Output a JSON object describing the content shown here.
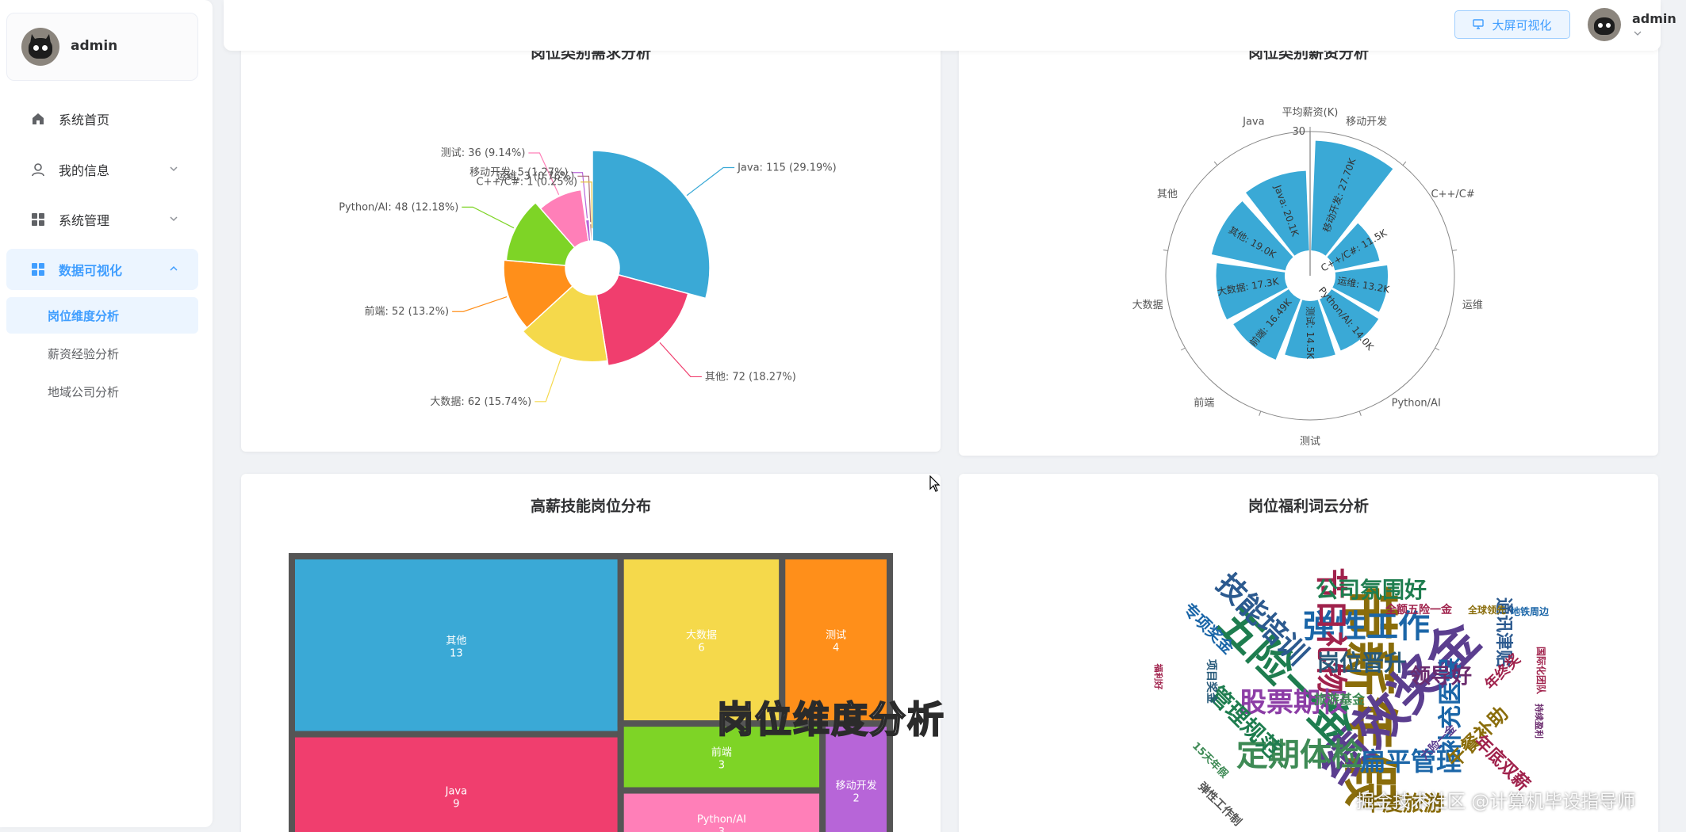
{
  "sidebar": {
    "user_name": "admin",
    "menu": [
      {
        "label": "系统首页",
        "icon": "home-icon"
      },
      {
        "label": "我的信息",
        "icon": "user-icon"
      },
      {
        "label": "系统管理",
        "icon": "grid-icon"
      },
      {
        "label": "数据可视化",
        "icon": "grid-icon"
      }
    ],
    "submenu": [
      {
        "label": "岗位维度分析"
      },
      {
        "label": "薪资经验分析"
      },
      {
        "label": "地域公司分析"
      }
    ]
  },
  "header": {
    "bigscreen_label": "大屏可视化",
    "user_name": "admin"
  },
  "colors": {
    "accent": "#409eff",
    "active_bg": "#ecf5ff"
  },
  "overlay": {
    "caption": "岗位维度分析",
    "watermark": "掘金技术社区 @计算机毕设指导师"
  },
  "cards": {
    "demand": {
      "title": "岗位类别需求分析"
    },
    "salary": {
      "title": "岗位类别薪资分析"
    },
    "treemap": {
      "title": "高薪技能岗位分布"
    },
    "wordcloud": {
      "title": "岗位福利词云分析"
    }
  },
  "chart_data": [
    {
      "type": "pie",
      "variant": "rose",
      "slices": [
        {
          "label": "Java",
          "value": 115,
          "percent": "29.19%",
          "color": "#3aa9d6"
        },
        {
          "label": "其他",
          "value": 72,
          "percent": "18.27%",
          "color": "#f03e6e"
        },
        {
          "label": "大数据",
          "value": 62,
          "percent": "15.74%",
          "color": "#f5d94b"
        },
        {
          "label": "前端",
          "value": 52,
          "percent": "13.2%",
          "color": "#ff8f1a"
        },
        {
          "label": "Python/AI",
          "value": 48,
          "percent": "12.18%",
          "color": "#7ed426"
        },
        {
          "label": "测试",
          "value": 36,
          "percent": "9.14%",
          "color": "#ff7fb8"
        },
        {
          "label": "移动开发",
          "value": 5,
          "percent": "1.27%",
          "color": "#b765d8"
        },
        {
          "label": "运维",
          "value": 3,
          "percent": "0.76%",
          "color": "#a86a78"
        },
        {
          "label": "C++/C#",
          "value": 1,
          "percent": "0.25%",
          "color": "#e8c23c"
        }
      ]
    },
    {
      "type": "bar",
      "variant": "polar",
      "radius_axis_name": "平均薪资(K)",
      "radius_max": 30,
      "color": "#3aa9d6",
      "categories": [
        "移动开发",
        "C++/C#",
        "运维",
        "Python/AI",
        "测试",
        "前端",
        "大数据",
        "其他",
        "Java"
      ],
      "values": [
        27.7,
        11.5,
        13.2,
        14.0,
        14.5,
        16.49,
        17.3,
        19.0,
        20.1
      ],
      "value_labels": [
        "移动开发: 27.70K",
        "C++/C#: 11.5K",
        "运维: 13.2K",
        "Python/AI: 14.0K",
        "测试: 14.5K",
        "前端: 16.49K",
        "大数据: 17.3K",
        "其他: 19.0K",
        "Java: 20.1K"
      ]
    },
    {
      "type": "treemap",
      "nodes": [
        {
          "label": "其他",
          "value": 13,
          "color": "#3aa9d6"
        },
        {
          "label": "Java",
          "value": 9,
          "color": "#f03e6e"
        },
        {
          "label": "大数据",
          "value": 6,
          "color": "#f5d94b"
        },
        {
          "label": "测试",
          "value": 4,
          "color": "#ff8f1a"
        },
        {
          "label": "前端",
          "value": 3,
          "color": "#7ed426"
        },
        {
          "label": "Python/AI",
          "value": 3,
          "color": "#ff7fb8"
        },
        {
          "label": "移动开发",
          "value": 2,
          "color": "#b765d8"
        }
      ]
    },
    {
      "type": "wordcloud",
      "words": [
        {
          "text": "带薪年假",
          "color": "#8a6d0b",
          "size": 70,
          "rotate": 90
        },
        {
          "text": "绩效奖金",
          "color": "#5b3e8f",
          "size": 64,
          "rotate": -45
        },
        {
          "text": "五险一金",
          "color": "#1e7d4f",
          "size": 54,
          "rotate": 45
        },
        {
          "text": "弹性工作",
          "color": "#1b66a8",
          "size": 40,
          "rotate": 0
        },
        {
          "text": "节日礼物",
          "color": "#a0224c",
          "size": 40,
          "rotate": 90
        },
        {
          "text": "技能培训",
          "color": "#2c5a8f",
          "size": 36,
          "rotate": 45
        },
        {
          "text": "定期体检",
          "color": "#3e8a55",
          "size": 40,
          "rotate": 0
        },
        {
          "text": "股票期权",
          "color": "#8c3da6",
          "size": 34,
          "rotate": 0
        },
        {
          "text": "公司氛围好",
          "color": "#1e7d4f",
          "size": 28,
          "rotate": 0
        },
        {
          "text": "岗位晋升",
          "color": "#285a7a",
          "size": 28,
          "rotate": 0
        },
        {
          "text": "管理规范",
          "color": "#1e7d4f",
          "size": 28,
          "rotate": 45
        },
        {
          "text": "扁平管理",
          "color": "#1b66a8",
          "size": 32,
          "rotate": 0
        },
        {
          "text": "补充医保",
          "color": "#1b66a8",
          "size": 30,
          "rotate": -90
        },
        {
          "text": "领导好",
          "color": "#6b2c6e",
          "size": 26,
          "rotate": 0
        },
        {
          "text": "午餐补助",
          "color": "#8a6d0b",
          "size": 24,
          "rotate": -45
        },
        {
          "text": "通讯津贴",
          "color": "#2c5a8f",
          "size": 22,
          "rotate": 90
        },
        {
          "text": "专项奖金",
          "color": "#1b66a8",
          "size": 20,
          "rotate": 45
        },
        {
          "text": "年终奖",
          "color": "#a0224c",
          "size": 18,
          "rotate": -45
        },
        {
          "text": "旅游基金",
          "color": "#3e8a55",
          "size": 16,
          "rotate": 0
        },
        {
          "text": "项目奖金",
          "color": "#285a7a",
          "size": 14,
          "rotate": 90
        },
        {
          "text": "全额五险一金",
          "color": "#a0224c",
          "size": 14,
          "rotate": 0
        },
        {
          "text": "全球领先",
          "color": "#8a6d0b",
          "size": 12,
          "rotate": 0
        },
        {
          "text": "地铁周边",
          "color": "#1b66a8",
          "size": 12,
          "rotate": 0
        },
        {
          "text": "国际化团队",
          "color": "#a0224c",
          "size": 12,
          "rotate": 90
        },
        {
          "text": "持续盈利",
          "color": "#6b2c6e",
          "size": 11,
          "rotate": 90
        },
        {
          "text": "15天年假",
          "color": "#3e8a55",
          "size": 13,
          "rotate": 45
        },
        {
          "text": "福利好",
          "color": "#a0224c",
          "size": 11,
          "rotate": 90
        },
        {
          "text": "六险一金",
          "color": "#5b3e8f",
          "size": 14,
          "rotate": -45
        },
        {
          "text": "年度旅游",
          "color": "#8a6d0b",
          "size": 26,
          "rotate": 0
        },
        {
          "text": "年底双薪",
          "color": "#a0224c",
          "size": 22,
          "rotate": 45
        },
        {
          "text": "弹性工作制",
          "color": "#555555",
          "size": 14,
          "rotate": 45
        }
      ]
    }
  ]
}
